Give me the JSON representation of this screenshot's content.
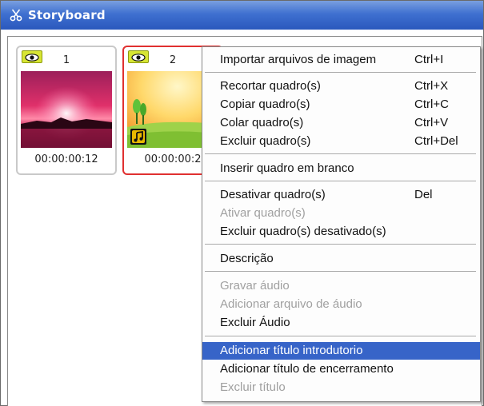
{
  "window": {
    "title": "Storyboard",
    "icon": "scissors-icon"
  },
  "frames": [
    {
      "number": "1",
      "time": "00:00:00:12",
      "selected": false,
      "eye_icon": "eye-icon"
    },
    {
      "number": "2",
      "time": "00:00:00:2",
      "selected": true,
      "eye_icon": "eye-icon",
      "badge_icon": "music-note-icon"
    }
  ],
  "menu": {
    "items": [
      {
        "label": "Importar arquivos de imagem",
        "shortcut": "Ctrl+I",
        "enabled": true
      },
      {
        "label": "Recortar quadro(s)",
        "shortcut": "Ctrl+X",
        "enabled": true
      },
      {
        "label": "Copiar quadro(s)",
        "shortcut": "Ctrl+C",
        "enabled": true
      },
      {
        "label": "Colar quadro(s)",
        "shortcut": "Ctrl+V",
        "enabled": true
      },
      {
        "label": "Excluir quadro(s)",
        "shortcut": "Ctrl+Del",
        "enabled": true
      },
      {
        "label": "Inserir quadro em branco",
        "shortcut": "",
        "enabled": true
      },
      {
        "label": "Desativar quadro(s)",
        "shortcut": "Del",
        "enabled": true
      },
      {
        "label": "Ativar quadro(s)",
        "shortcut": "",
        "enabled": false
      },
      {
        "label": "Excluir quadro(s) desativado(s)",
        "shortcut": "",
        "enabled": true
      },
      {
        "label": "Descrição",
        "shortcut": "",
        "enabled": true
      },
      {
        "label": "Gravar áudio",
        "shortcut": "",
        "enabled": false
      },
      {
        "label": "Adicionar arquivo de áudio",
        "shortcut": "",
        "enabled": false
      },
      {
        "label": "Excluir Áudio",
        "shortcut": "",
        "enabled": true
      },
      {
        "label": "Adicionar título introdutorio",
        "shortcut": "",
        "enabled": true,
        "highlighted": true
      },
      {
        "label": "Adicionar título de encerramento",
        "shortcut": "",
        "enabled": true
      },
      {
        "label": "Excluir título",
        "shortcut": "",
        "enabled": false
      }
    ]
  },
  "colors": {
    "titlebar": "#3f70d0",
    "selected_frame_border": "#e03030",
    "menu_highlight": "#3764c8",
    "disabled_text": "#a0a0a0"
  }
}
